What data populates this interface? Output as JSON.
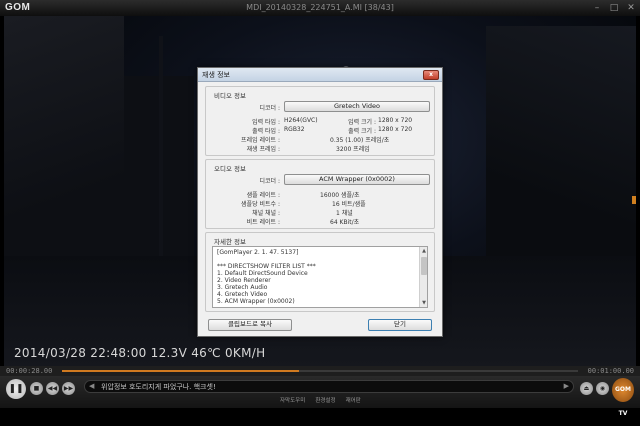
{
  "window": {
    "app_logo": "GOM",
    "title": "MDI_20140328_224751_A.MI  [38/43]",
    "minimize": "–",
    "maximize": "□",
    "close": "✕"
  },
  "osd": "2014/03/28 22:48:00 12.3V 46℃  0KM/H",
  "seek": {
    "current": "00:00:28.00",
    "total": "00:01:00.00",
    "progress": 0.46
  },
  "message": "위압정보 호도리지게 파었구나. 핵크셋!",
  "bottom_links": [
    "자막도우미",
    "환경설정",
    "재어판"
  ],
  "tv_badge": "GOM TV",
  "dialog": {
    "title": "재생 정보",
    "close": "x",
    "video": {
      "header": "비디오 정보",
      "decoder_label": "디코더 :",
      "decoder_value": "Gretech Video",
      "input_type_label": "입력 타입 :",
      "input_type_value": "H264(GVC)",
      "input_size_label": "입력 크기 :",
      "input_size_value": "1280 x 720",
      "output_type_label": "출력 타입 :",
      "output_type_value": "RGB32",
      "output_size_label": "출력 크기 :",
      "output_size_value": "1280 x 720",
      "framerate_label": "프레임 레이트 :",
      "framerate_value": "0.35 (1.00) 프레임/초",
      "played_frames_label": "재생 프레임 :",
      "played_frames_value": "3200 프레임"
    },
    "audio": {
      "header": "오디오 정보",
      "decoder_label": "디코더 :",
      "decoder_value": "ACM Wrapper (0x0002)",
      "samplerate_label": "샘플 레이트 :",
      "samplerate_value": "16000 샘플/초",
      "bits_label": "샘플당 비트수 :",
      "bits_value": "16 비트/샘플",
      "channels_label": "채널 채널 :",
      "channels_value": "1 채널",
      "bitrate_label": "비트 레이트 :",
      "bitrate_value": "64 KBit/초"
    },
    "detail": {
      "header": "자세한 정보",
      "lines": [
        "[GomPlayer 2. 1. 47. 5137]",
        "",
        "*** DIRECTSHOW FILTER LIST ***",
        "1. Default DirectSound Device",
        "2. Video Renderer",
        "3. Gretech Audio",
        "4. Gretech Video",
        "5. ACM Wrapper (0x0002)"
      ]
    },
    "copy_button": "클립보드로 복사",
    "close_button": "닫기"
  }
}
